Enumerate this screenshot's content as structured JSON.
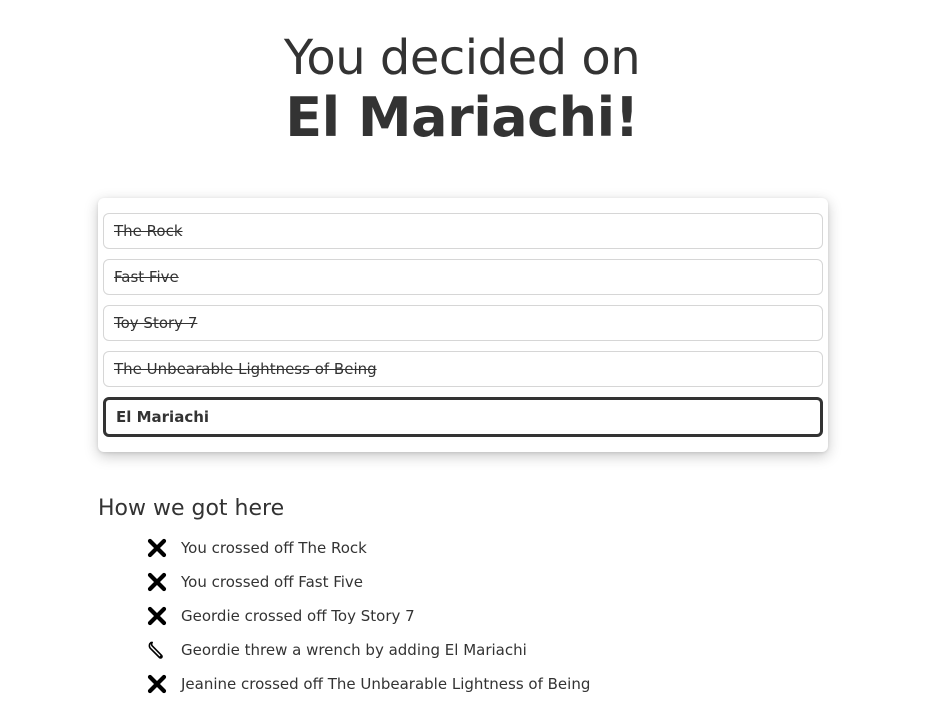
{
  "headline": {
    "line1": "You decided on",
    "line2": "El Mariachi!"
  },
  "options": [
    {
      "label": "The Rock",
      "state": "crossed"
    },
    {
      "label": "Fast Five",
      "state": "crossed"
    },
    {
      "label": "Toy Story 7",
      "state": "crossed"
    },
    {
      "label": "The Unbearable Lightness of Being",
      "state": "crossed"
    },
    {
      "label": "El Mariachi",
      "state": "chosen"
    }
  ],
  "history": {
    "title": "How we got here",
    "items": [
      {
        "icon": "cross-icon",
        "text": "You crossed off The Rock"
      },
      {
        "icon": "cross-icon",
        "text": "You crossed off Fast Five"
      },
      {
        "icon": "cross-icon",
        "text": "Geordie crossed off Toy Story 7"
      },
      {
        "icon": "wrench-icon",
        "text": "Geordie threw a wrench by adding El Mariachi"
      },
      {
        "icon": "cross-icon",
        "text": "Jeanine crossed off The Unbearable Lightness of Being"
      }
    ]
  }
}
